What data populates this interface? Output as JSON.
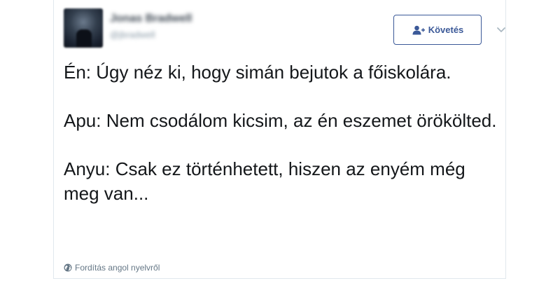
{
  "user": {
    "display_name": "Jonas Bradwell",
    "handle": "@jbradwell"
  },
  "follow_button": {
    "label": "Követés",
    "icon": "add-user-icon"
  },
  "menu": {
    "icon": "chevron-down-icon"
  },
  "tweet": {
    "paragraphs": [
      "Én: Úgy néz ki, hogy simán bejutok a főiskolára.",
      "Apu: Nem csodálom kicsim, az én eszemet örökölted.",
      "Anyu: Csak ez történhetett, hiszen az enyém még meg van..."
    ]
  },
  "translate": {
    "label": "Fordítás angol nyelvről",
    "icon": "globe-icon"
  },
  "colors": {
    "accent": "#3b5998",
    "text": "#14171a",
    "muted": "#657786",
    "border": "#e1e8ed"
  }
}
